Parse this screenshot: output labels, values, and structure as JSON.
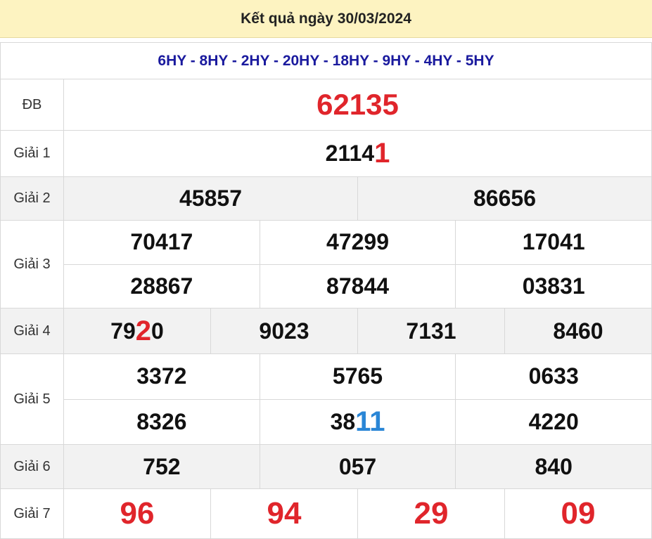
{
  "header": {
    "title": "Kết quả ngày 30/03/2024"
  },
  "codes": "6HY - 8HY - 2HY - 20HY - 18HY - 9HY - 4HY - 5HY",
  "labels": {
    "db": "ĐB",
    "g1": "Giải 1",
    "g2": "Giải 2",
    "g3": "Giải 3",
    "g4": "Giải 4",
    "g5": "Giải 5",
    "g6": "Giải 6",
    "g7": "Giải 7"
  },
  "prizes": {
    "db": "62135",
    "g1": {
      "prefix": "2114",
      "highlight": "1"
    },
    "g2": [
      "45857",
      "86656"
    ],
    "g3": [
      "70417",
      "47299",
      "17041",
      "28867",
      "87844",
      "03831"
    ],
    "g4": [
      {
        "prefix": "79",
        "highlight": "2",
        "suffix": "0"
      },
      {
        "prefix": "9023",
        "highlight": "",
        "suffix": ""
      },
      {
        "prefix": "7131",
        "highlight": "",
        "suffix": ""
      },
      {
        "prefix": "8460",
        "highlight": "",
        "suffix": ""
      }
    ],
    "g5": [
      {
        "prefix": "3372",
        "highlight": ""
      },
      {
        "prefix": "5765",
        "highlight": ""
      },
      {
        "prefix": "0633",
        "highlight": ""
      },
      {
        "prefix": "8326",
        "highlight": ""
      },
      {
        "prefix": "38",
        "highlight": "11"
      },
      {
        "prefix": "4220",
        "highlight": ""
      }
    ],
    "g6": [
      "752",
      "057",
      "840"
    ],
    "g7": [
      "96",
      "94",
      "29",
      "09"
    ]
  },
  "colors": {
    "highlight_red": "#e0252b",
    "highlight_blue": "#2a86d6",
    "codes_blue": "#1a1a9e",
    "header_bg": "#fdf3c1"
  }
}
